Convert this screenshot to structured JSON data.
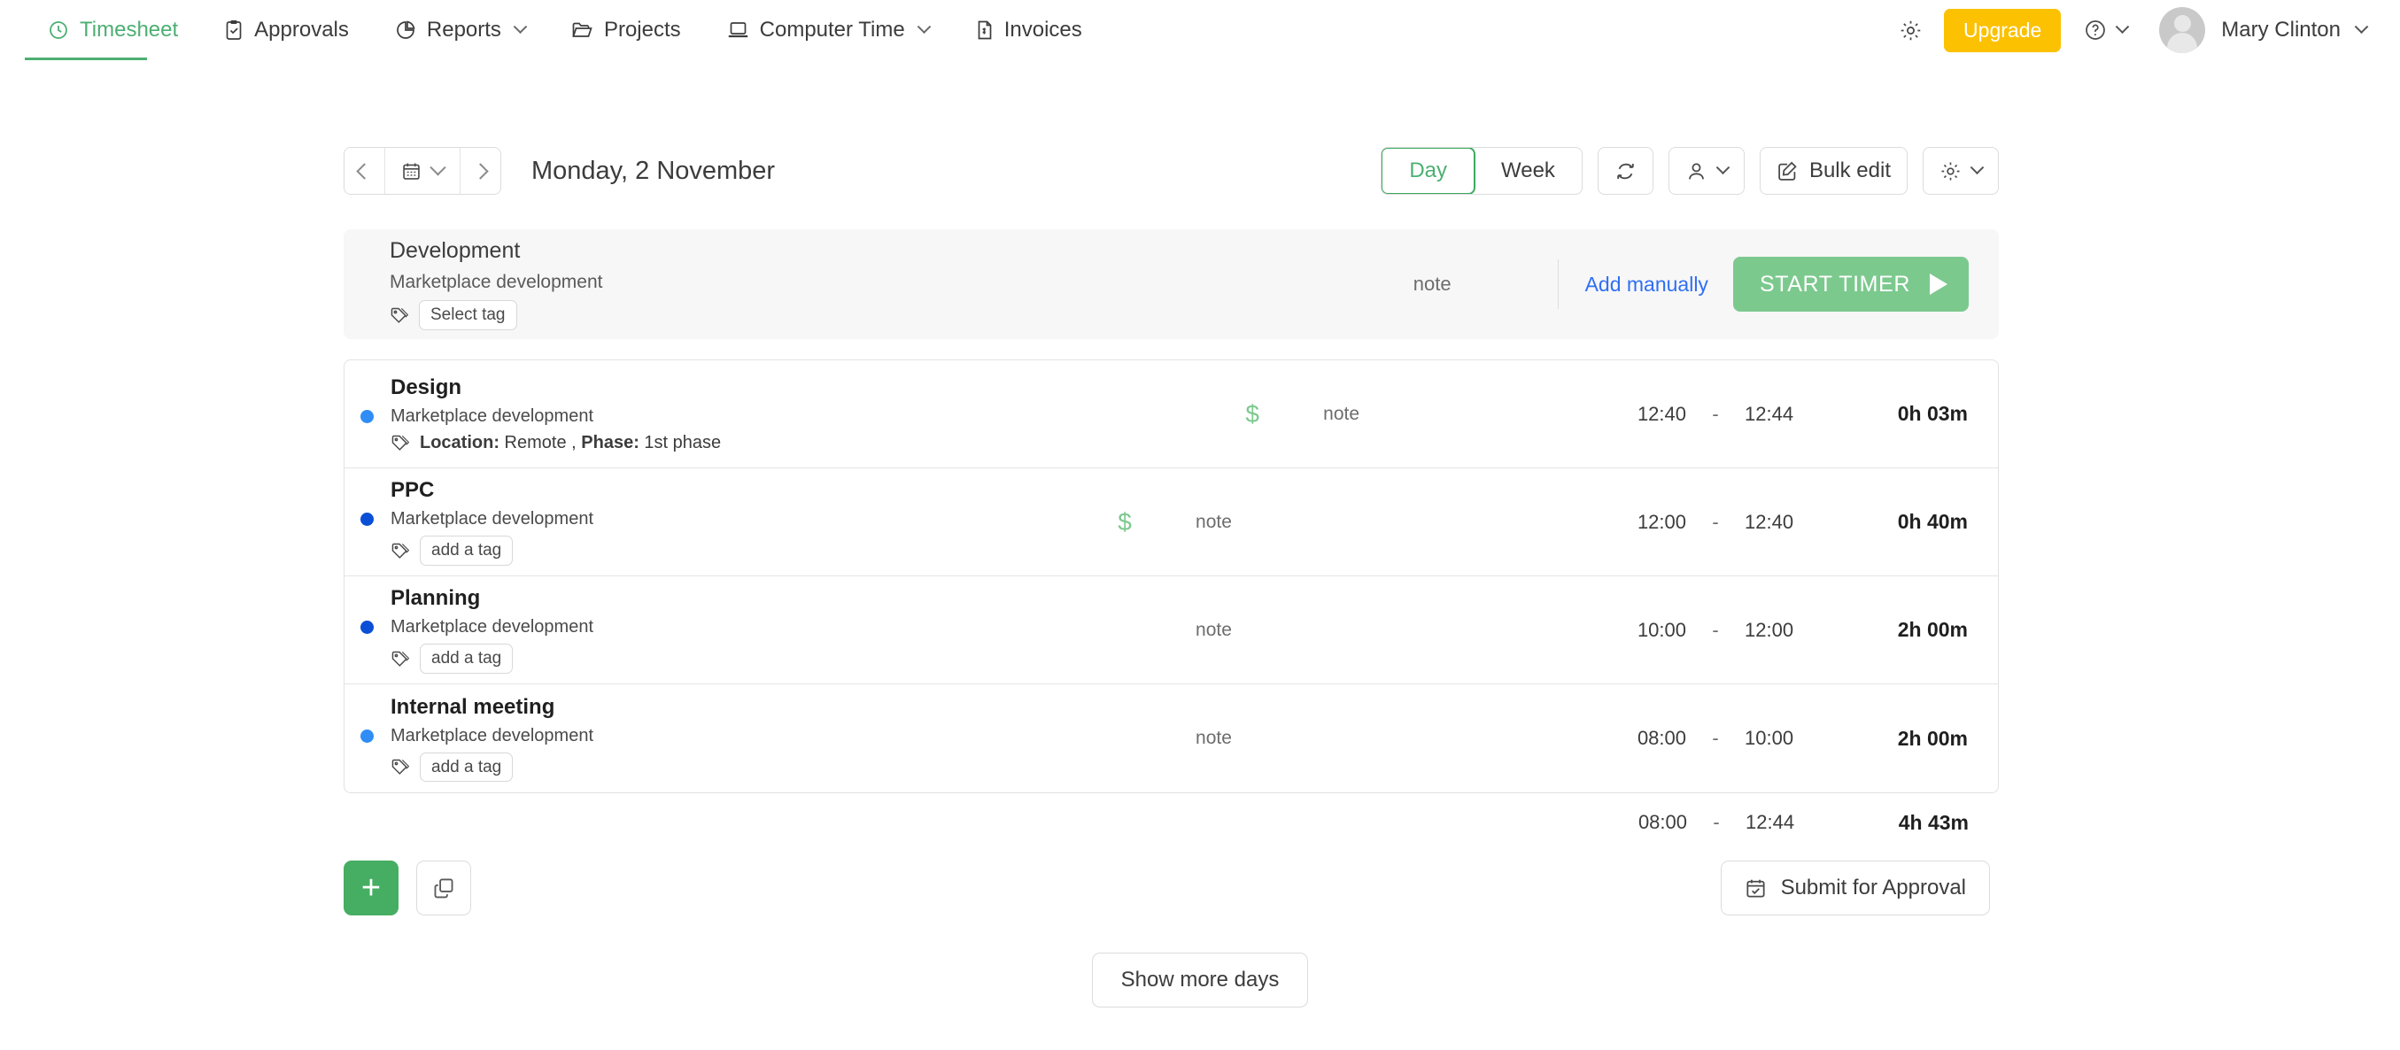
{
  "nav": {
    "items": [
      {
        "label": "Timesheet",
        "icon": "clock-icon",
        "active": true,
        "caret": false
      },
      {
        "label": "Approvals",
        "icon": "clipboard-check-icon",
        "active": false,
        "caret": false
      },
      {
        "label": "Reports",
        "icon": "pie-chart-icon",
        "active": false,
        "caret": true
      },
      {
        "label": "Projects",
        "icon": "folder-icon",
        "active": false,
        "caret": false
      },
      {
        "label": "Computer Time",
        "icon": "laptop-icon",
        "active": false,
        "caret": true
      },
      {
        "label": "Invoices",
        "icon": "invoice-icon",
        "active": false,
        "caret": false
      }
    ],
    "settings_icon": "gear-icon",
    "upgrade_label": "Upgrade",
    "help_icon": "question-circle-icon",
    "user_name": "Mary Clinton",
    "accent_green": "#4caf72",
    "upgrade_yellow": "#fcc100"
  },
  "toolbar": {
    "prev_icon": "chevron-left-icon",
    "calendar_icon": "calendar-icon",
    "next_icon": "chevron-right-icon",
    "date_title": "Monday, 2 November",
    "view_day": "Day",
    "view_week": "Week",
    "active_view": "Day",
    "refresh_icon": "refresh-icon",
    "user_filter_icon": "user-icon",
    "bulk_edit_label": "Bulk edit",
    "bulk_edit_icon": "edit-square-icon",
    "settings_icon": "gear-icon"
  },
  "timer": {
    "title": "Development",
    "project": "Marketplace development",
    "tag_icon": "tag-icon",
    "tag_label": "Select tag",
    "note_placeholder": "note",
    "add_manually": "Add manually",
    "start_timer": "START TIMER",
    "start_timer_color": "#7cc98e"
  },
  "entries": [
    {
      "title": "Design",
      "project": "Marketplace development",
      "dot_color": "#2f8df5",
      "tag_icon": "tag-icon",
      "tag_kind": "text",
      "tag_text_parts": [
        {
          "text": "Location:",
          "bold": true
        },
        {
          "text": " Remote , ",
          "bold": false
        },
        {
          "text": "Phase:",
          "bold": true
        },
        {
          "text": " 1st phase",
          "bold": false
        }
      ],
      "tag_label": "",
      "billable": "$",
      "note_placeholder": "note",
      "start": "12:40",
      "dash": "-",
      "end": "12:44",
      "duration": "0h 03m"
    },
    {
      "title": "PPC",
      "project": "Marketplace development",
      "dot_color": "#0b4fd6",
      "tag_icon": "tag-icon",
      "tag_kind": "chip",
      "tag_text_parts": [],
      "tag_label": "add a tag",
      "billable": "$",
      "note_placeholder": "note",
      "start": "12:00",
      "dash": "-",
      "end": "12:40",
      "duration": "0h 40m"
    },
    {
      "title": "Planning",
      "project": "Marketplace development",
      "dot_color": "#0b4fd6",
      "tag_icon": "tag-icon",
      "tag_kind": "chip",
      "tag_text_parts": [],
      "tag_label": "add a tag",
      "billable": "",
      "note_placeholder": "note",
      "start": "10:00",
      "dash": "-",
      "end": "12:00",
      "duration": "2h 00m"
    },
    {
      "title": "Internal meeting",
      "project": "Marketplace development",
      "dot_color": "#2f8df5",
      "tag_icon": "tag-icon",
      "tag_kind": "chip",
      "tag_text_parts": [],
      "tag_label": "add a tag",
      "billable": "",
      "note_placeholder": "note",
      "start": "08:00",
      "dash": "-",
      "end": "10:00",
      "duration": "2h 00m"
    }
  ],
  "totals": {
    "start": "08:00",
    "dash": "-",
    "end": "12:44",
    "duration": "4h 43m"
  },
  "footer": {
    "add_label": "+",
    "copy_icon": "copy-icon",
    "submit_icon": "calendar-check-icon",
    "submit_label": "Submit for Approval",
    "show_more_label": "Show more days"
  }
}
